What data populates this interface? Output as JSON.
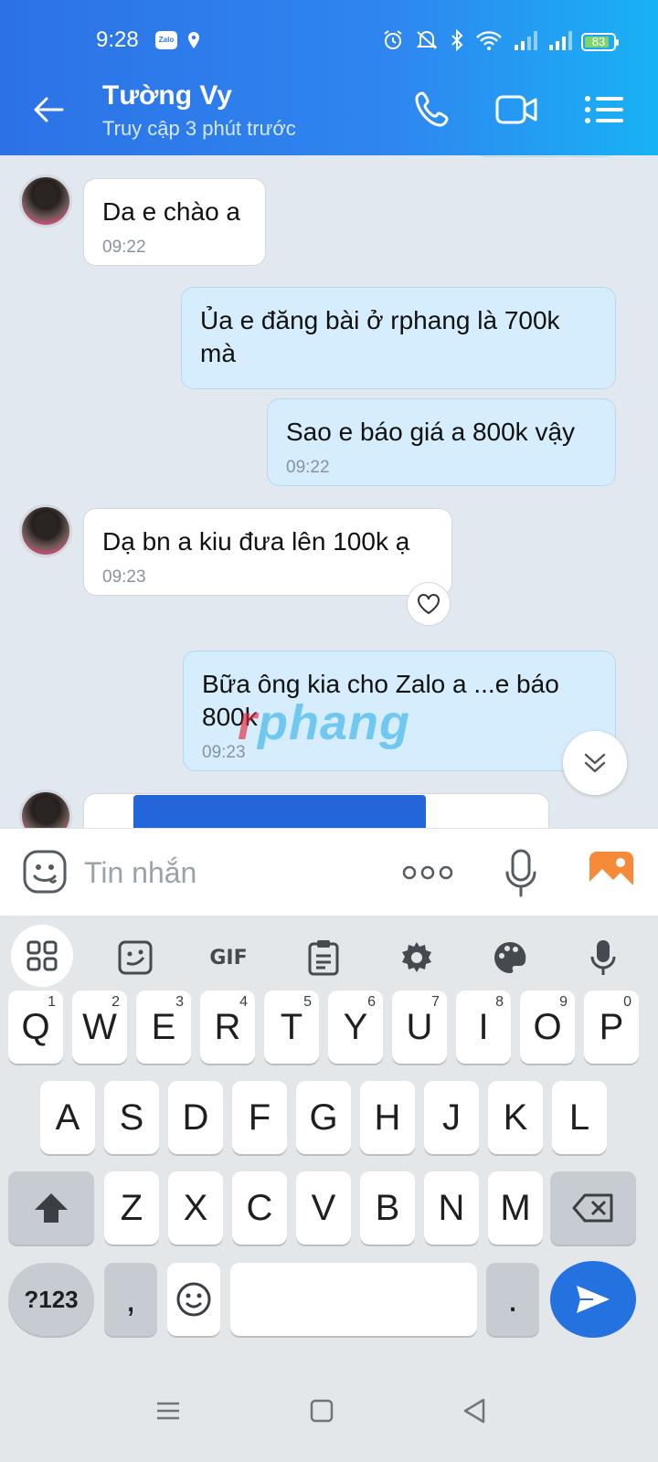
{
  "status_bar": {
    "time": "9:28",
    "zalo_badge": "Zalo",
    "battery": "83"
  },
  "header": {
    "contact_name": "Tường Vy",
    "contact_status": "Truy cập 3 phút trước"
  },
  "messages": [
    {
      "side": "in",
      "text": "Da e chào a",
      "time": "09:22"
    },
    {
      "side": "out",
      "text": "Ủa e đăng bài ở rphang là 700k mà",
      "time": ""
    },
    {
      "side": "out",
      "text": "Sao e báo giá a 800k vậy",
      "time": "09:22"
    },
    {
      "side": "in",
      "text": "Dạ bn a kiu đưa lên 100k ạ",
      "time": "09:23"
    },
    {
      "side": "out",
      "text": "Bữa ông kia cho Zalo a ...e báo 800k",
      "time": "09:23"
    }
  ],
  "watermark": {
    "first": "r",
    "rest": "phang"
  },
  "composer": {
    "placeholder": "Tin nhắn"
  },
  "keyboard": {
    "gif_label": "GIF",
    "row1": [
      {
        "k": "Q",
        "n": "1"
      },
      {
        "k": "W",
        "n": "2"
      },
      {
        "k": "E",
        "n": "3"
      },
      {
        "k": "R",
        "n": "4"
      },
      {
        "k": "T",
        "n": "5"
      },
      {
        "k": "Y",
        "n": "6"
      },
      {
        "k": "U",
        "n": "7"
      },
      {
        "k": "I",
        "n": "8"
      },
      {
        "k": "O",
        "n": "9"
      },
      {
        "k": "P",
        "n": "0"
      }
    ],
    "row2": [
      "A",
      "S",
      "D",
      "F",
      "G",
      "H",
      "J",
      "K",
      "L"
    ],
    "row3": [
      "Z",
      "X",
      "C",
      "V",
      "B",
      "N",
      "M"
    ],
    "symbols_label": "?123",
    "comma": ",",
    "period": "."
  }
}
